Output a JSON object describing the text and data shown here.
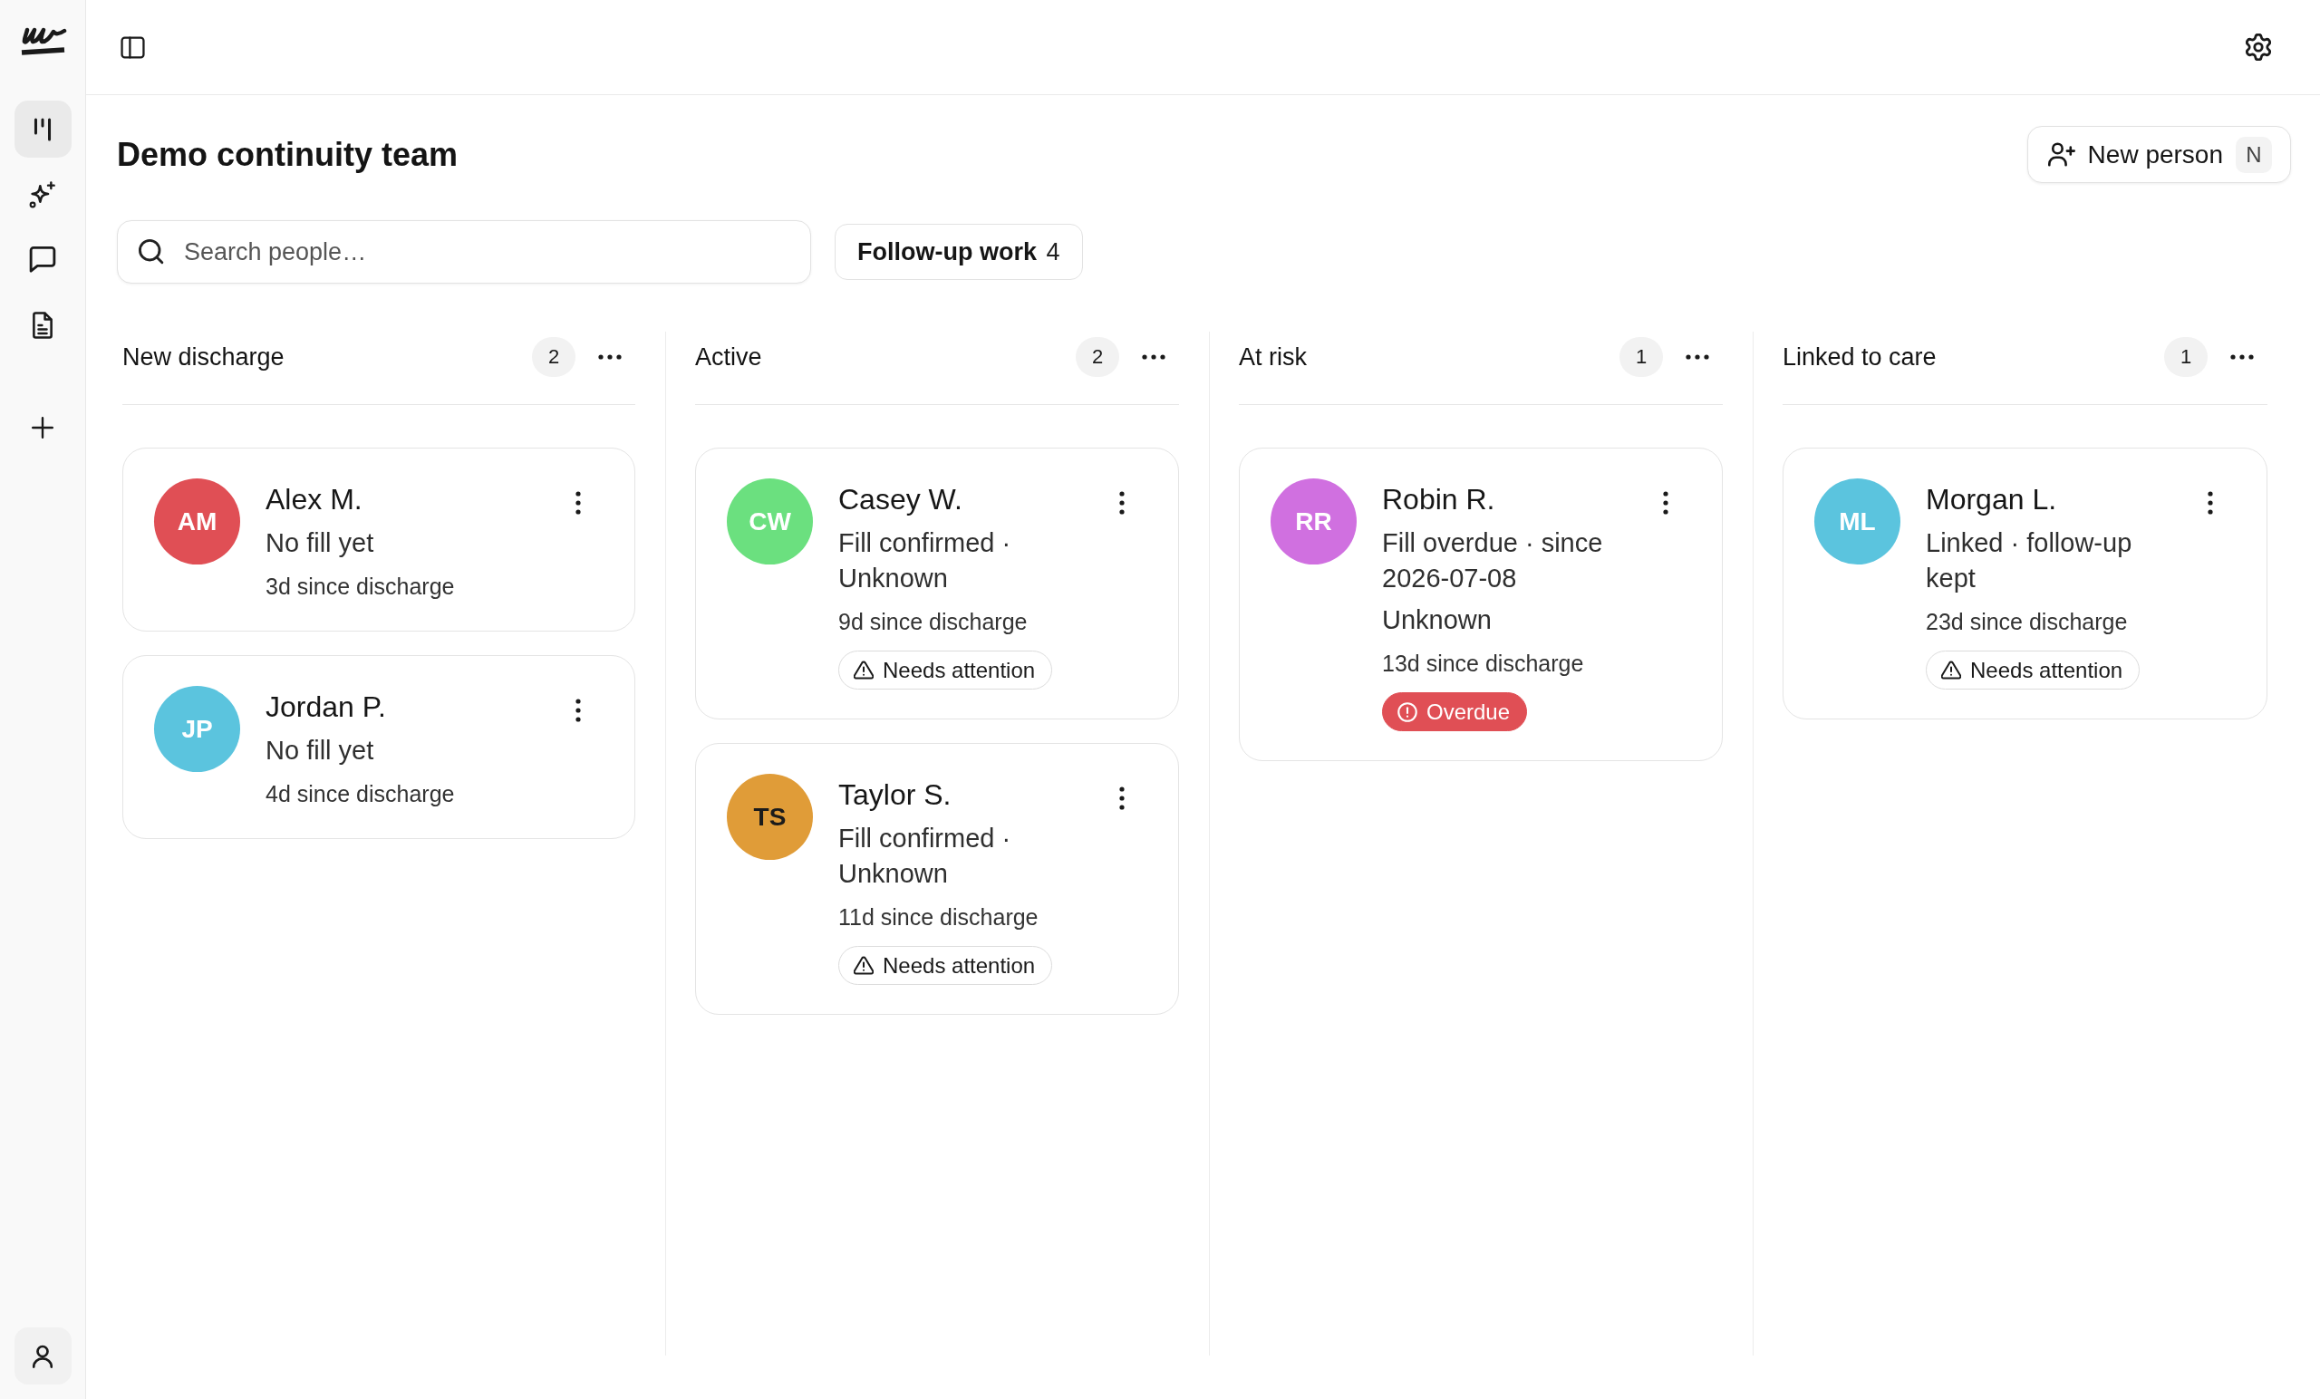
{
  "sidebar": {
    "items": [
      {
        "kind": "columns",
        "selected": true
      },
      {
        "kind": "sparkle",
        "selected": false
      },
      {
        "kind": "chat",
        "selected": false
      },
      {
        "kind": "document",
        "selected": false
      }
    ]
  },
  "header": {
    "title": "Demo continuity team",
    "new_person_button": {
      "label": "New person",
      "shortcut": "N"
    }
  },
  "search": {
    "placeholder": "Search people…"
  },
  "follow_up_button": {
    "label": "Follow-up work",
    "count": "4"
  },
  "columns": [
    {
      "title": "New discharge",
      "count": "2",
      "cards": [
        {
          "name": "Alex M.",
          "avatar": {
            "initials": "AM",
            "color": "#e04f55",
            "dark_initials": false
          },
          "status": [
            "No fill yet"
          ],
          "since": "3d since discharge"
        },
        {
          "name": "Jordan P.",
          "avatar": {
            "initials": "JP",
            "color": "#5bc4de",
            "dark_initials": false
          },
          "status": [
            "No fill yet"
          ],
          "since": "4d since discharge"
        }
      ]
    },
    {
      "title": "Active",
      "count": "2",
      "cards": [
        {
          "name": "Casey W.",
          "avatar": {
            "initials": "CW",
            "color": "#6be07f",
            "dark_initials": false
          },
          "status": [
            "Fill confirmed · Unknown"
          ],
          "since": "9d since discharge",
          "tag": {
            "kind": "attention",
            "label": "Needs attention"
          }
        },
        {
          "name": "Taylor S.",
          "avatar": {
            "initials": "TS",
            "color": "#e09c38",
            "dark_initials": true
          },
          "status": [
            "Fill confirmed · Unknown"
          ],
          "since": "11d since discharge",
          "tag": {
            "kind": "attention",
            "label": "Needs attention"
          }
        }
      ]
    },
    {
      "title": "At risk",
      "count": "1",
      "cards": [
        {
          "name": "Robin R.",
          "avatar": {
            "initials": "RR",
            "color": "#d070e0",
            "dark_initials": false
          },
          "status": [
            "Fill overdue · since 2026-07-08",
            "Unknown"
          ],
          "since": "13d since discharge",
          "tag": {
            "kind": "overdue",
            "label": "Overdue"
          }
        }
      ]
    },
    {
      "title": "Linked to care",
      "count": "1",
      "cards": [
        {
          "name": "Morgan L.",
          "avatar": {
            "initials": "ML",
            "color": "#5bc4de",
            "dark_initials": false
          },
          "status": [
            "Linked · follow-up kept"
          ],
          "since": "23d since discharge",
          "tag": {
            "kind": "attention",
            "label": "Needs attention"
          }
        }
      ]
    }
  ]
}
